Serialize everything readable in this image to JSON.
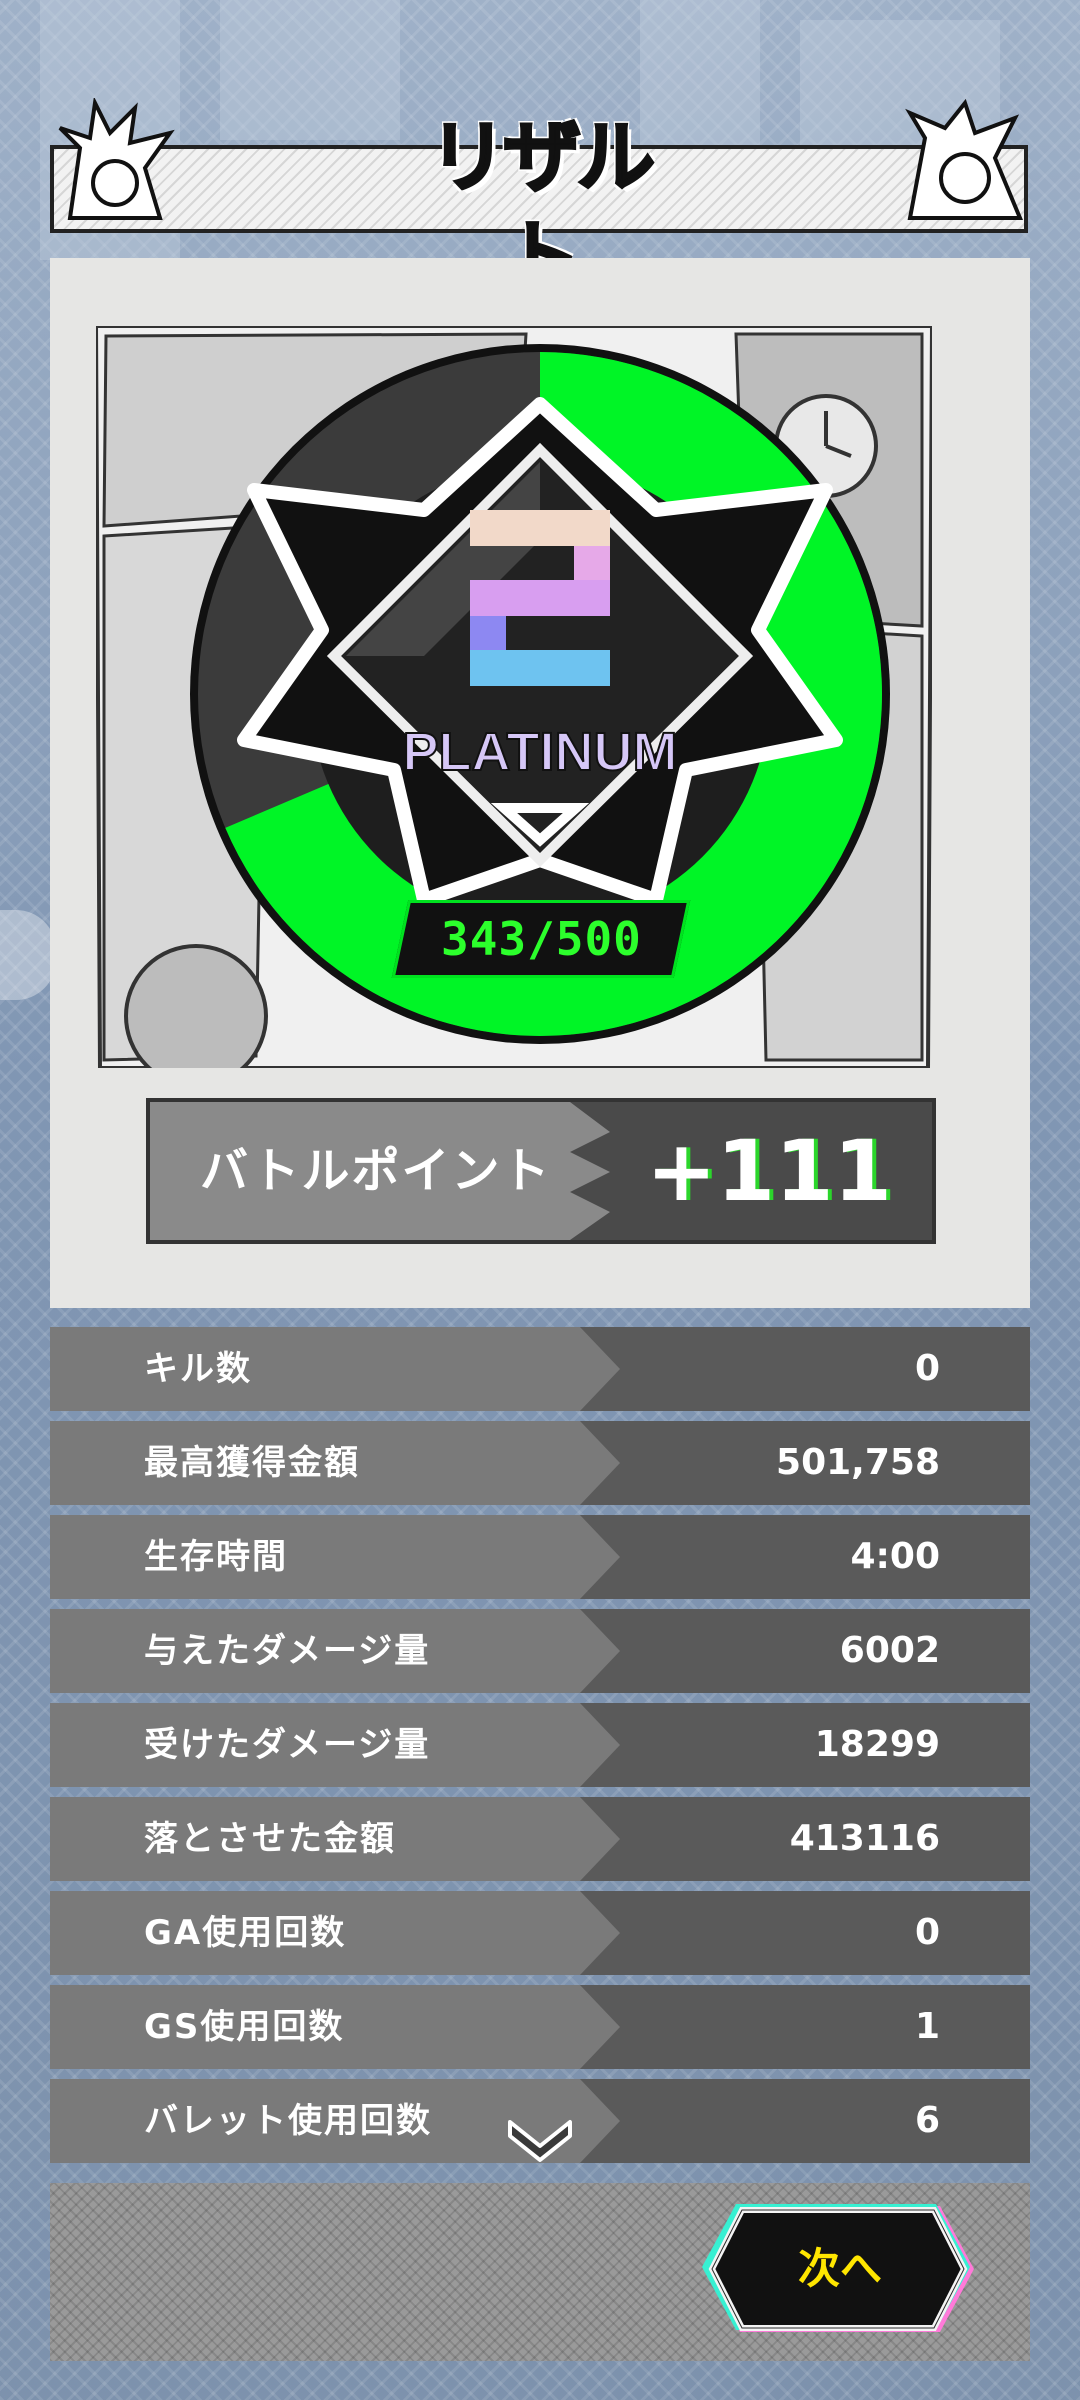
{
  "title": "リザルト",
  "rank": {
    "tier": "PLATINUM",
    "level": "2",
    "points_text": "343/500",
    "progress": 0.686
  },
  "battle_points": {
    "label": "バトルポイント",
    "value": "+111"
  },
  "stats": [
    {
      "label": "キル数",
      "value": "0"
    },
    {
      "label": "最高獲得金額",
      "value": "501,758"
    },
    {
      "label": "生存時間",
      "value": "4:00"
    },
    {
      "label": "与えたダメージ量",
      "value": "6002"
    },
    {
      "label": "受けたダメージ量",
      "value": "18299"
    },
    {
      "label": "落とさせた金額",
      "value": "413116"
    },
    {
      "label": "GA使用回数",
      "value": "0"
    },
    {
      "label": "GS使用回数",
      "value": "1"
    },
    {
      "label": "バレット使用回数",
      "value": "6"
    }
  ],
  "next_button": "次へ",
  "colors": {
    "progress_green": "#00f526",
    "progress_dark": "#3b3b3b",
    "badge_text": "#2cff2c",
    "next_text": "#ffe600"
  }
}
